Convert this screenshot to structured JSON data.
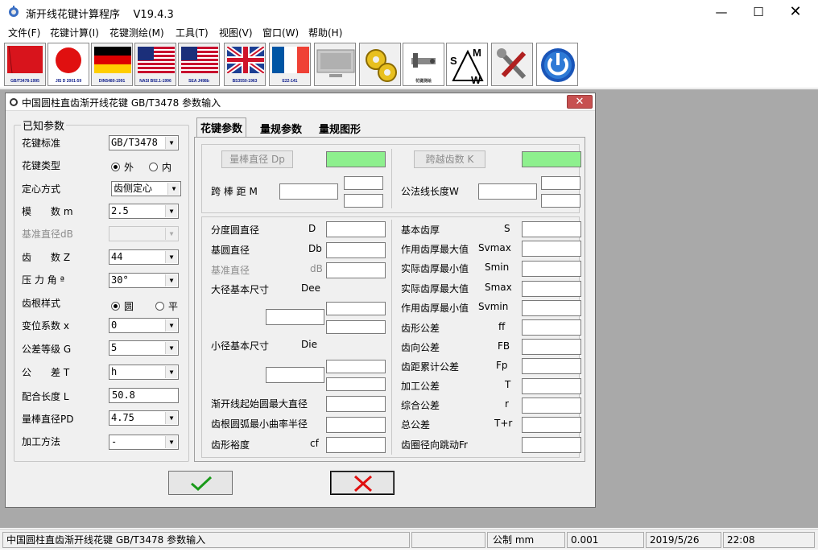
{
  "app": {
    "title": "渐开线花键计算程序    V19.4.3"
  },
  "menu": [
    "文件(F)",
    "花键计算(I)",
    "花键测绘(M)",
    "工具(T)",
    "视图(V)",
    "窗口(W)",
    "帮助(H)"
  ],
  "toolbar": [
    {
      "caption": "GB/T3478-1995",
      "icon": "china-flag-icon"
    },
    {
      "caption": "JIS D 2001-59",
      "icon": "japan-flag-icon"
    },
    {
      "caption": "DIN5480-1991",
      "icon": "germany-flag-icon"
    },
    {
      "caption": "NASI B92.1-1996",
      "icon": "usa-flag-icon"
    },
    {
      "caption": "SEA J498b",
      "icon": "usa-flag-icon"
    },
    {
      "caption": "BS3550-1963",
      "icon": "uk-flag-icon"
    },
    {
      "caption": "E22-141",
      "icon": "france-flag-icon"
    },
    {
      "caption": "",
      "icon": "monitor-icon"
    },
    {
      "caption": "",
      "icon": "gears-icon"
    },
    {
      "caption": "花键测绘",
      "icon": "measure-icon"
    },
    {
      "caption": "",
      "icon": "sw-icon"
    },
    {
      "caption": "",
      "icon": "tools-icon"
    },
    {
      "caption": "",
      "icon": "power-icon"
    }
  ],
  "dialog": {
    "title": "中国圆柱直齿渐开线花键 GB/T3478 参数输入",
    "known_group": "已知参数",
    "fields": {
      "standard": {
        "label": "花键标准",
        "value": "GB/T3478"
      },
      "type": {
        "label": "花键类型",
        "opt1": "外",
        "opt2": "内"
      },
      "centering": {
        "label": "定心方式",
        "value": "齿侧定心"
      },
      "module": {
        "label": "模　　数 m",
        "value": "2.5"
      },
      "ref_dia": {
        "label": "基准直径dB",
        "value": ""
      },
      "teeth": {
        "label": "齿　　数 Z",
        "value": "44"
      },
      "pressure": {
        "label": "压 力 角 ª",
        "value": "30°"
      },
      "root": {
        "label": "齿根样式",
        "opt1": "圆",
        "opt2": "平"
      },
      "shift": {
        "label": "变位系数 x",
        "value": "0"
      },
      "grade": {
        "label": "公差等级 G",
        "value": "5"
      },
      "tolerance": {
        "label": "公　　差 T",
        "value": "h"
      },
      "length": {
        "label": "配合长度 L",
        "value": "50.8"
      },
      "pin": {
        "label": "量棒直径PD",
        "value": "4.75"
      },
      "process": {
        "label": "加工方法",
        "value": "-"
      }
    },
    "tabs": [
      "花键参数",
      "量规参数",
      "量规图形"
    ],
    "measure": {
      "pin_btn": "量棒直径 Dp",
      "span_btn": "跨越齿数  K",
      "over_pins": "跨 棒 距  M",
      "base_tangent": "公法线长度W"
    },
    "left_results": [
      {
        "label": "分度圆直径",
        "sym": "D"
      },
      {
        "label": "基圆直径",
        "sym": "Db"
      },
      {
        "label": "基准直径",
        "sym": "dB"
      },
      {
        "label": "大径基本尺寸",
        "sym": "Dee"
      },
      {
        "label": "小径基本尺寸",
        "sym": "Die"
      },
      {
        "label": "渐开线起始圆最大直径",
        "sym": ""
      },
      {
        "label": "齿根圆弧最小曲率半径",
        "sym": ""
      },
      {
        "label": "齿形裕度",
        "sym": "cf"
      }
    ],
    "right_results": [
      {
        "label": "基本齿厚",
        "sym": "S"
      },
      {
        "label": "作用齿厚最大值",
        "sym": "Svmax"
      },
      {
        "label": "实际齿厚最小值",
        "sym": "Smin"
      },
      {
        "label": "实际齿厚最大值",
        "sym": "Smax"
      },
      {
        "label": "作用齿厚最小值",
        "sym": "Svmin"
      },
      {
        "label": "齿形公差",
        "sym": "ff"
      },
      {
        "label": "齿向公差",
        "sym": "FB"
      },
      {
        "label": "齿距累计公差",
        "sym": "Fp"
      },
      {
        "label": "加工公差",
        "sym": "T"
      },
      {
        "label": "综合公差",
        "sym": "r"
      },
      {
        "label": "总公差",
        "sym": "T+r"
      },
      {
        "label": "齿圈径向跳动Fr",
        "sym": ""
      }
    ]
  },
  "status": {
    "text": "中国圆柱直齿渐开线花键  GB/T3478 参数输入",
    "unit": "公制 mm",
    "precision": "0.001",
    "date": "2019/5/26",
    "time": "22:08"
  }
}
